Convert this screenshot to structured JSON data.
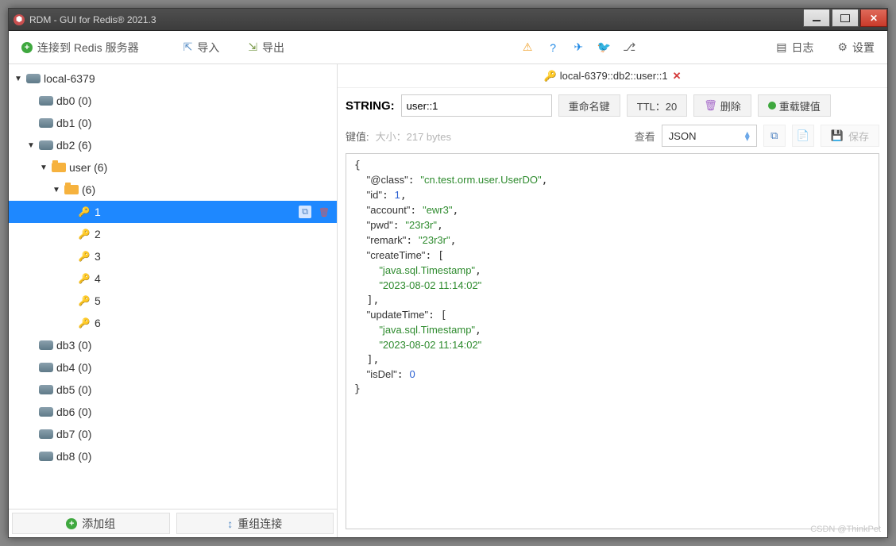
{
  "window": {
    "title": "RDM - GUI for Redis® 2021.3"
  },
  "toolbar": {
    "connect": "连接到 Redis 服务器",
    "import": "导入",
    "export": "导出",
    "log": "日志",
    "settings": "设置"
  },
  "tree": {
    "connection": "local-6379",
    "dbs": [
      {
        "name": "db0",
        "count": "(0)",
        "expanded": false
      },
      {
        "name": "db1",
        "count": "(0)",
        "expanded": false
      },
      {
        "name": "db2",
        "count": "(6)",
        "expanded": true
      },
      {
        "name": "db3",
        "count": "(0)",
        "expanded": false
      },
      {
        "name": "db4",
        "count": "(0)",
        "expanded": false
      },
      {
        "name": "db5",
        "count": "(0)",
        "expanded": false
      },
      {
        "name": "db6",
        "count": "(0)",
        "expanded": false
      },
      {
        "name": "db7",
        "count": "(0)",
        "expanded": false
      },
      {
        "name": "db8",
        "count": "(0)",
        "expanded": false
      }
    ],
    "folder_user": "user (6)",
    "folder_anon": "(6)",
    "keys": [
      "1",
      "2",
      "3",
      "4",
      "5",
      "6"
    ],
    "selected_key": "1"
  },
  "sidebar_footer": {
    "add_group": "添加组",
    "reconnect": "重组连接"
  },
  "tab": {
    "title": "local-6379::db2::user::1"
  },
  "key_panel": {
    "type_label": "STRING:",
    "key_name": "user::1",
    "rename": "重命名键",
    "ttl_label": "TTL：20",
    "delete": "删除",
    "reload": "重载键值"
  },
  "value_bar": {
    "label": "键值:",
    "size": "大小：217 bytes",
    "view": "查看",
    "format": "JSON",
    "save": "保存"
  },
  "json_value": {
    "@class": "cn.test.orm.user.UserDO",
    "id": 1,
    "account": "ewr3",
    "pwd": "23r3r",
    "remark": "23r3r",
    "createTime": [
      "java.sql.Timestamp",
      "2023-08-02 11:14:02"
    ],
    "updateTime": [
      "java.sql.Timestamp",
      "2023-08-02 11:14:02"
    ],
    "isDel": 0
  },
  "watermark": "CSDN @ThinkPet"
}
